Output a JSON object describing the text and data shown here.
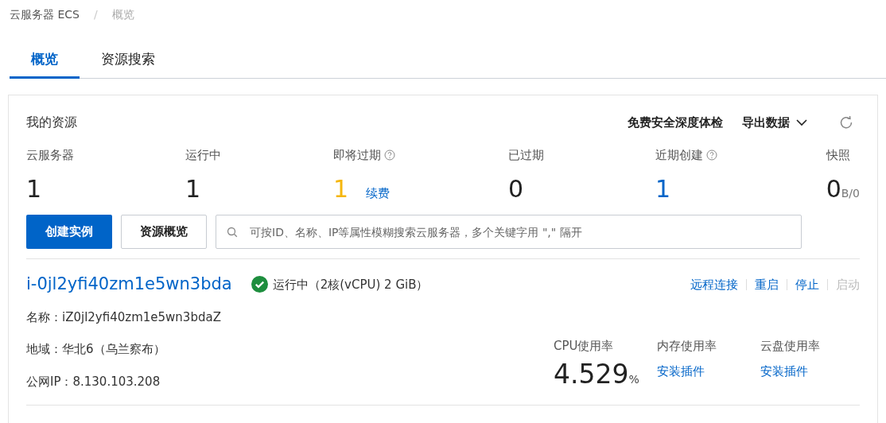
{
  "breadcrumb": [
    {
      "label": "云服务器 ECS",
      "current": false
    },
    {
      "label": "概览",
      "current": true
    }
  ],
  "breadcrumb_separator": "/",
  "tabs": [
    {
      "label": "概览",
      "selected": true
    },
    {
      "label": "资源搜索",
      "selected": false
    }
  ],
  "resources": {
    "title": "我的资源",
    "check_link": "免费安全深度体检",
    "export_menu": "导出数据",
    "stats": [
      {
        "label": "云服务器",
        "help": false,
        "value": "1",
        "kind": "plain"
      },
      {
        "label": "运行中",
        "help": false,
        "value": "1",
        "kind": "plain"
      },
      {
        "label": "即将过期",
        "help": true,
        "value": "1",
        "kind": "warning",
        "action": "续费"
      },
      {
        "label": "已过期",
        "help": false,
        "value": "0",
        "kind": "plain"
      },
      {
        "label": "近期创建",
        "help": true,
        "value": "1",
        "kind": "link"
      },
      {
        "label": "快照",
        "help": false,
        "value": "0",
        "kind": "plain",
        "unit": "B/0"
      }
    ],
    "create_button": "创建实例",
    "overview_button": "资源概览",
    "search": {
      "placeholder": "可按ID、名称、IP等属性模糊搜索云服务器，多个关键字用 \",\" 隔开"
    }
  },
  "instance": {
    "id": "i-0jl2yfi40zm1e5wn3bda",
    "status": "运行中",
    "status_ok": true,
    "spec": "（2核(vCPU) 2 GiB）",
    "actions": [
      {
        "label": "远程连接",
        "disabled": false
      },
      {
        "label": "重启",
        "disabled": false
      },
      {
        "label": "停止",
        "disabled": false
      },
      {
        "label": "启动",
        "disabled": true
      }
    ],
    "fields": [
      {
        "label": "名称：",
        "value": "iZ0jl2yfi40zm1e5wn3bdaZ"
      },
      {
        "label": "地域：",
        "value": "华北6（乌兰察布）"
      },
      {
        "label": "公网IP：",
        "value": "8.130.103.208"
      }
    ],
    "metrics": [
      {
        "label": "CPU使用率",
        "value": "4.529",
        "unit": "%"
      },
      {
        "label": "内存使用率",
        "link": "安装插件"
      },
      {
        "label": "云盘使用率",
        "link": "安装插件"
      }
    ]
  }
}
